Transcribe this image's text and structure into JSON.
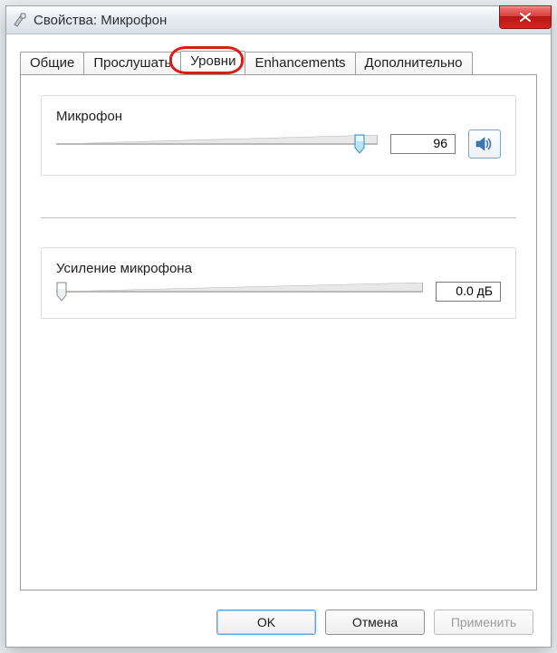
{
  "window": {
    "title": "Свойства: Микрофон"
  },
  "tabs": {
    "general": "Общие",
    "listen": "Прослушать",
    "levels": "Уровни",
    "enhancements": "Enhancements",
    "advanced": "Дополнительно",
    "active": "levels"
  },
  "mic": {
    "label": "Микрофон",
    "value": "96",
    "percent": 96
  },
  "boost": {
    "label": "Усиление микрофона",
    "value": "0.0 дБ",
    "percent": 0
  },
  "buttons": {
    "ok": "OK",
    "cancel": "Отмена",
    "apply": "Применить"
  },
  "icons": {
    "speaker": "speaker-icon",
    "close": "close-icon",
    "app": "microphone-icon"
  }
}
